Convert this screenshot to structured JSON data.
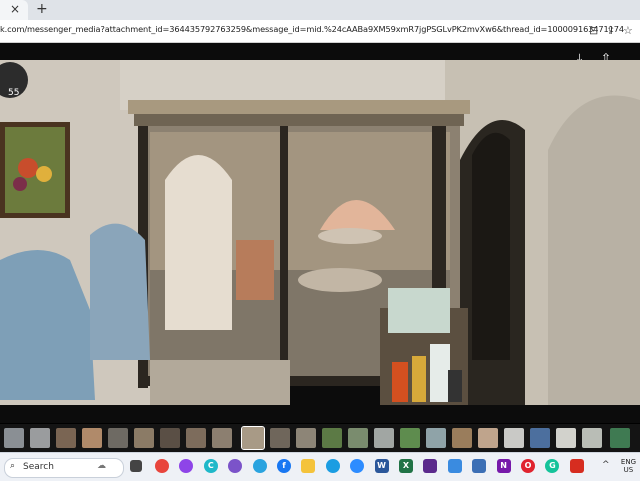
{
  "browser": {
    "tab_close": "×",
    "new_tab": "+",
    "url": "k.com/messenger_media?attachment_id=364435792763259&message_id=mid.%24cAABa9XM59xmR7jgPSGLvPK2mvXw6&thread_id=100009163471174"
  },
  "viewer": {
    "clock_text": "55"
  },
  "taskbar": {
    "search_label": "Search",
    "lang_line1": "ENG",
    "lang_line2": "US",
    "icons": [
      {
        "name": "chrome",
        "color": "#e8453c",
        "glyph": ""
      },
      {
        "name": "messenger",
        "color": "#8e44e8",
        "glyph": ""
      },
      {
        "name": "canva",
        "color": "#1fb8c9",
        "glyph": "C"
      },
      {
        "name": "viber",
        "color": "#7b53c9",
        "glyph": ""
      },
      {
        "name": "telegram",
        "color": "#2aa3df",
        "glyph": ""
      },
      {
        "name": "facebook",
        "color": "#1877f2",
        "glyph": "f"
      },
      {
        "name": "file-explorer",
        "color": "#f4c33b",
        "glyph": ""
      },
      {
        "name": "edge",
        "color": "#1b9de2",
        "glyph": ""
      },
      {
        "name": "zoom",
        "color": "#2d8cff",
        "glyph": ""
      },
      {
        "name": "word",
        "color": "#2b579a",
        "glyph": "W"
      },
      {
        "name": "excel",
        "color": "#217346",
        "glyph": "X"
      },
      {
        "name": "video-editor",
        "color": "#5b2a8c",
        "glyph": ""
      },
      {
        "name": "photos",
        "color": "#3a8be0",
        "glyph": ""
      },
      {
        "name": "calculator",
        "color": "#3c6fb5",
        "glyph": ""
      },
      {
        "name": "onenote",
        "color": "#7719aa",
        "glyph": "N"
      },
      {
        "name": "opera",
        "color": "#e0232e",
        "glyph": "O"
      },
      {
        "name": "grammarly",
        "color": "#15c39a",
        "glyph": "G"
      },
      {
        "name": "pdf-reader",
        "color": "#d62d20",
        "glyph": ""
      }
    ]
  }
}
